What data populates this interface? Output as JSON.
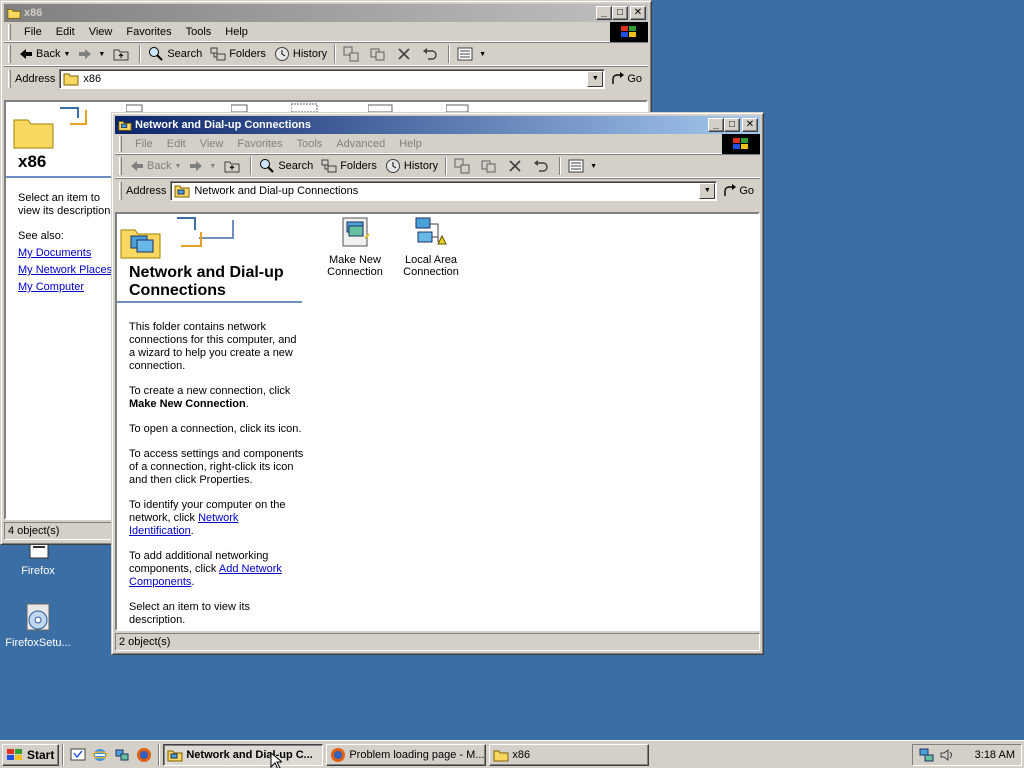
{
  "desktop": {
    "background": "#3a6ea5",
    "icons": [
      {
        "label": "Firefox",
        "icon": "firefox-icon"
      },
      {
        "label": "FirefoxSetu...",
        "icon": "installer-icon"
      }
    ]
  },
  "back_window": {
    "title": "x86",
    "menu": [
      "File",
      "Edit",
      "View",
      "Favorites",
      "Tools",
      "Help"
    ],
    "toolbar": {
      "back": "Back",
      "search": "Search",
      "folders": "Folders",
      "history": "History"
    },
    "address_label": "Address",
    "address_value": "x86",
    "go_label": "Go",
    "panel": {
      "heading": "x86",
      "desc": "Select an item to view its description.",
      "see_also": "See also:",
      "links": [
        "My Documents",
        "My Network Places",
        "My Computer"
      ]
    },
    "status": "4 object(s)"
  },
  "front_window": {
    "title": "Network and Dial-up Connections",
    "menu": [
      "File",
      "Edit",
      "View",
      "Favorites",
      "Tools",
      "Advanced",
      "Help"
    ],
    "toolbar": {
      "back": "Back",
      "search": "Search",
      "folders": "Folders",
      "history": "History"
    },
    "address_label": "Address",
    "address_value": "Network and Dial-up Connections",
    "go_label": "Go",
    "panel": {
      "heading": "Network and Dial-up Connections",
      "p1": "This folder contains network connections for this computer, and a wizard to help you create a new connection.",
      "p2_pre": "To create a new connection, click",
      "p2_bold": "Make New Connection",
      "p3": "To open a connection, click its icon.",
      "p4": "To access settings and components of a connection, right-click its icon and then click Properties.",
      "p5_pre": "To identify your computer on the network, click",
      "p5_link": "Network Identification",
      "p6_pre": "To add additional networking components, click",
      "p6_link": "Add Network Components",
      "p7": "Select an item to view its description."
    },
    "items": [
      {
        "label_line1": "Make New",
        "label_line2": "Connection",
        "icon": "make-new-connection-icon"
      },
      {
        "label_line1": "Local Area",
        "label_line2": "Connection",
        "icon": "local-area-connection-icon"
      }
    ],
    "status": "2 object(s)"
  },
  "taskbar": {
    "start": "Start",
    "tasks": [
      {
        "label": "Network and Dial-up C...",
        "pressed": true
      },
      {
        "label": "Problem loading page - M...",
        "pressed": false
      },
      {
        "label": "x86",
        "pressed": false
      }
    ],
    "clock": "3:18 AM"
  }
}
